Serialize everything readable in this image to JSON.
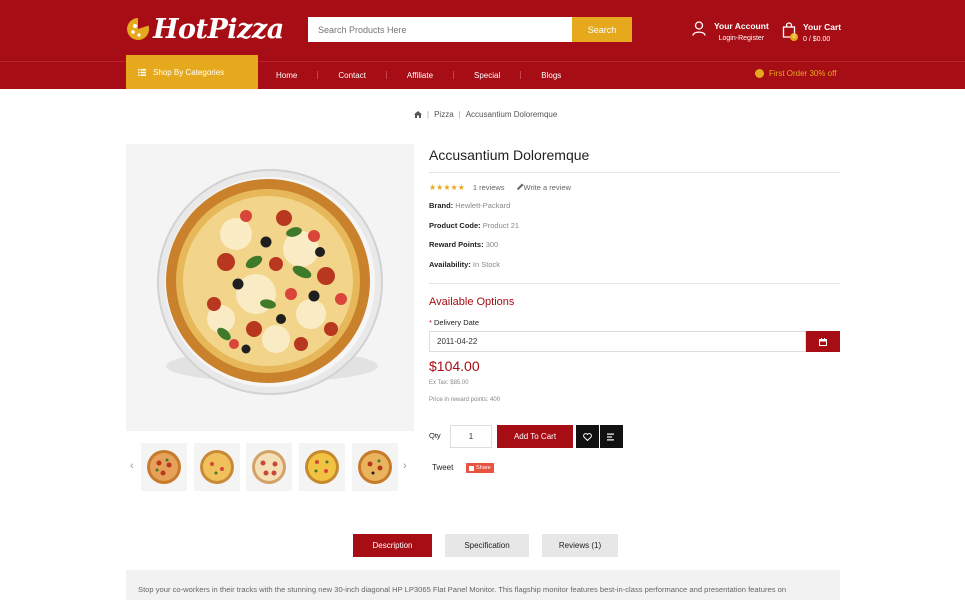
{
  "brand": {
    "name": "HotPizza"
  },
  "search": {
    "placeholder": "Search Products Here",
    "button": "Search"
  },
  "account": {
    "title": "Your Account",
    "links": "Login-Register"
  },
  "cart": {
    "title": "Your Cart",
    "summary": "0 / $0.00",
    "count": "0"
  },
  "nav": {
    "categories": "Shop By Categories",
    "items": [
      {
        "label": "Home"
      },
      {
        "label": "Contact"
      },
      {
        "label": "Affiliate"
      },
      {
        "label": "Special"
      },
      {
        "label": "Blogs"
      }
    ],
    "offer": "First Order 30% off"
  },
  "breadcrumb": {
    "items": [
      "Pizza",
      "Accusantium Doloremque"
    ]
  },
  "product": {
    "title": "Accusantium Doloremque",
    "rating": 5,
    "reviews_text": "1 reviews",
    "write_review": "Write a review",
    "brand_label": "Brand:",
    "brand_value": "Hewlett-Packard",
    "code_label": "Product Code:",
    "code_value": "Product 21",
    "points_label": "Reward Points:",
    "points_value": "300",
    "availability_label": "Availability:",
    "availability_value": "In Stock",
    "options_title": "Available Options",
    "delivery_label": "Delivery Date",
    "delivery_value": "2011-04-22",
    "price": "$104.00",
    "ex_tax": "Ex Tax: $85.00",
    "reward_price": "Price in reward points: 400",
    "qty_label": "Qty",
    "qty_value": "1",
    "add_to_cart": "Add To Cart",
    "tweet": "Tweet",
    "share": "Share"
  },
  "tabs": [
    {
      "label": "Description"
    },
    {
      "label": "Specification"
    },
    {
      "label": "Reviews (1)"
    }
  ],
  "description": "Stop your co-workers in their tracks with the stunning new 30-inch diagonal HP LP3065 Flat Panel Monitor. This flagship monitor features best-in-class performance and presentation features on",
  "colors": {
    "brand_red": "#a60d14",
    "accent_gold": "#e6a91d"
  },
  "icons": [
    "pizza-logo-icon",
    "user-icon",
    "cart-bag-icon",
    "menu-bars-icon",
    "coin-icon",
    "home-icon",
    "star-icon",
    "pencil-icon",
    "calendar-icon",
    "heart-icon",
    "compare-icon",
    "chevron-left-icon",
    "chevron-right-icon"
  ]
}
